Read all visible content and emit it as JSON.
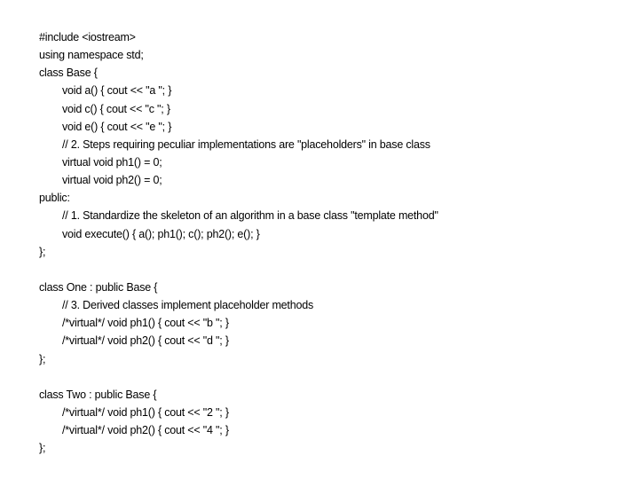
{
  "lines": [
    {
      "text": "#include <iostream>",
      "indent": 0
    },
    {
      "text": "using namespace std;",
      "indent": 0
    },
    {
      "text": "class Base {",
      "indent": 0
    },
    {
      "text": "void a() { cout << \"a \"; }",
      "indent": 1
    },
    {
      "text": "void c() { cout << \"c \"; }",
      "indent": 1
    },
    {
      "text": "void e() { cout << \"e \"; }",
      "indent": 1
    },
    {
      "text": "// 2. Steps requiring peculiar implementations are \"placeholders\" in base class",
      "indent": 1
    },
    {
      "text": "virtual void ph1() = 0;",
      "indent": 1
    },
    {
      "text": "virtual void ph2() = 0;",
      "indent": 1
    },
    {
      "text": "public:",
      "indent": 0
    },
    {
      "text": "// 1. Standardize the skeleton of an algorithm in a base class \"template method\"",
      "indent": 1
    },
    {
      "text": "void execute() { a(); ph1(); c(); ph2(); e(); }",
      "indent": 1
    },
    {
      "text": "};",
      "indent": 0
    },
    {
      "text": "",
      "indent": 0
    },
    {
      "text": "class One : public Base {",
      "indent": 0
    },
    {
      "text": "// 3. Derived classes implement placeholder methods",
      "indent": 1
    },
    {
      "text": "/*virtual*/ void ph1() { cout << \"b \"; }",
      "indent": 1
    },
    {
      "text": "/*virtual*/ void ph2() { cout << \"d \"; }",
      "indent": 1
    },
    {
      "text": "};",
      "indent": 0
    },
    {
      "text": "",
      "indent": 0
    },
    {
      "text": "class Two : public Base {",
      "indent": 0
    },
    {
      "text": "/*virtual*/ void ph1() { cout << \"2 \"; }",
      "indent": 1
    },
    {
      "text": "/*virtual*/ void ph2() { cout << \"4 \"; }",
      "indent": 1
    },
    {
      "text": "};",
      "indent": 0
    }
  ]
}
